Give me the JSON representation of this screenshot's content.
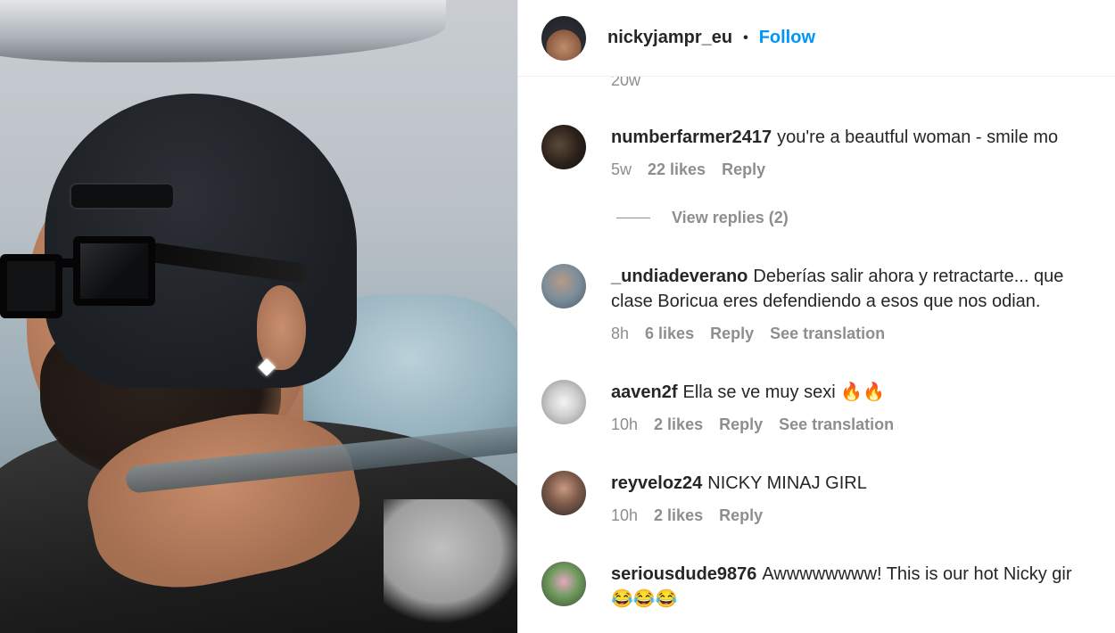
{
  "post": {
    "username": "nickyjampr_eu",
    "separator": "•",
    "follow_label": "Follow",
    "top_timestamp": "20w"
  },
  "comments": [
    {
      "username": "numberfarmer2417",
      "text": "you're a beautful woman - smile mo",
      "time": "5w",
      "likes": "22 likes",
      "reply": "Reply",
      "view_replies": "View replies (2)"
    },
    {
      "username": "_undiadeverano",
      "text_line1": "Deberías salir ahora y retractarte... que",
      "text_line2": "clase Boricua eres defendiendo a esos que nos odian.",
      "time": "8h",
      "likes": "6 likes",
      "reply": "Reply",
      "translation": "See translation"
    },
    {
      "username": "aaven2f",
      "text": "Ella se ve muy sexi 🔥🔥",
      "time": "10h",
      "likes": "2 likes",
      "reply": "Reply",
      "translation": "See translation"
    },
    {
      "username": "reyveloz24",
      "text": "NICKY MINAJ GIRL",
      "time": "10h",
      "likes": "2 likes",
      "reply": "Reply"
    },
    {
      "username": "seriousdude9876",
      "text_line1": "Awwwwwwww! This is our hot Nicky gir",
      "text_line2": "😂😂😂"
    }
  ]
}
